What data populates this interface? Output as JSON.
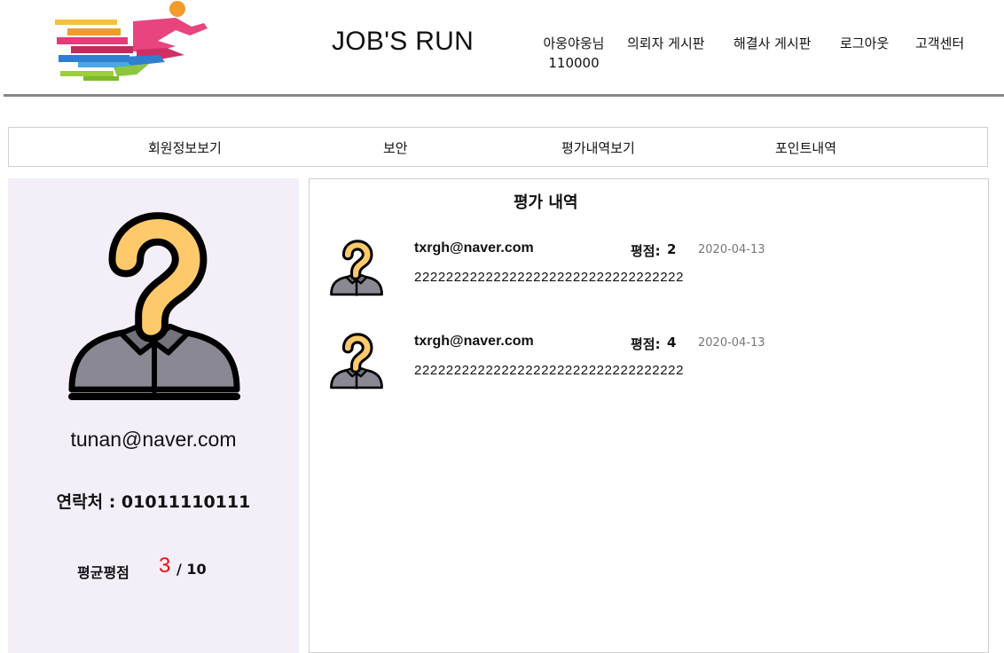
{
  "header": {
    "site_title": "JOB'S RUN",
    "user_name": "아웅야웅님",
    "user_points": "110000",
    "nav": [
      {
        "label": "의뢰자 게시판"
      },
      {
        "label": "해결사 게시판"
      },
      {
        "label": "로그아웃"
      },
      {
        "label": "고객센터"
      }
    ]
  },
  "tabs": [
    {
      "label": "회원정보보기"
    },
    {
      "label": "보안"
    },
    {
      "label": "평가내역보기"
    },
    {
      "label": "포인트내역"
    }
  ],
  "profile": {
    "email": "tunan@naver.com",
    "contact_label": "연락처 :",
    "contact_value": "01011110111",
    "rating_label": "평균평점",
    "rating_value": "3",
    "rating_max": "/ 10"
  },
  "reviews": {
    "title": "평가 내역",
    "score_label": "평점:",
    "items": [
      {
        "email": "txrgh@naver.com",
        "score": "2",
        "date": "2020-04-13",
        "text": "2222222222222222222222222222222222"
      },
      {
        "email": "txrgh@naver.com",
        "score": "4",
        "date": "2020-04-13",
        "text": "2222222222222222222222222222222222"
      }
    ]
  },
  "colors": {
    "rating_value": "#ee1111",
    "profile_bg": "#f3eef8",
    "header_rule": "#888888"
  },
  "icons": {
    "logo": "running-person-logo",
    "avatar": "question-mark-person-icon"
  }
}
